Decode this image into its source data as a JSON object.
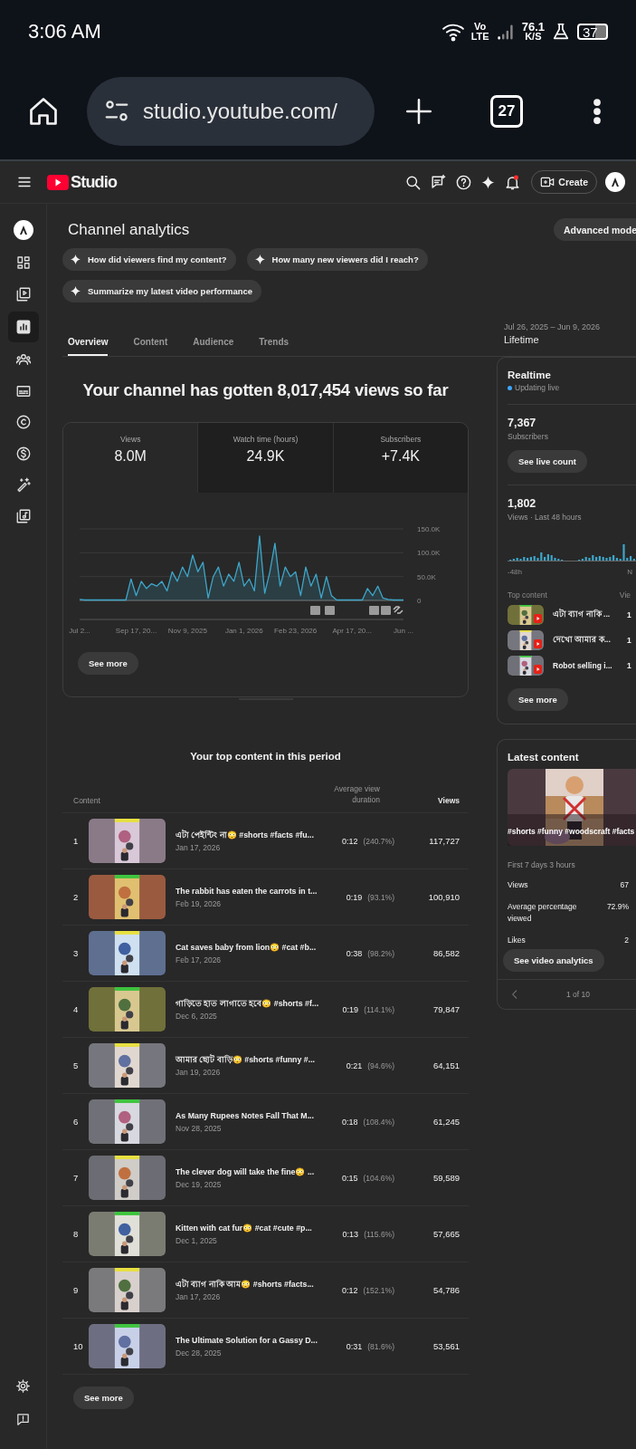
{
  "status_bar": {
    "time": "3:06 AM",
    "network_top": "Vo",
    "network_bottom": "LTE",
    "speed": "76.1",
    "speed_unit": "K/S",
    "battery": "37"
  },
  "browser": {
    "url": "studio.youtube.com/",
    "tab_count": "27"
  },
  "header": {
    "logo_text": "Studio",
    "create_label": "Create"
  },
  "sidebar": {
    "items": [
      {
        "kind": "avatar",
        "selected": false
      },
      {
        "kind": "dashboard",
        "selected": false
      },
      {
        "kind": "content",
        "selected": false
      },
      {
        "kind": "analytics",
        "selected": true
      },
      {
        "kind": "community",
        "selected": false
      },
      {
        "kind": "subtitles",
        "selected": false
      },
      {
        "kind": "copyright",
        "selected": false
      },
      {
        "kind": "earn",
        "selected": false
      },
      {
        "kind": "customization",
        "selected": false
      },
      {
        "kind": "audio",
        "selected": false
      }
    ],
    "bottom_items": [
      {
        "kind": "settings"
      },
      {
        "kind": "feedback"
      }
    ]
  },
  "page": {
    "title": "Channel analytics",
    "advanced_mode": "Advanced mode",
    "suggestions": [
      "How did viewers find my content?",
      "How many new viewers did I reach?",
      "Summarize my latest video performance"
    ],
    "tabs": [
      {
        "label": "Overview",
        "selected": true
      },
      {
        "label": "Content",
        "selected": false
      },
      {
        "label": "Audience",
        "selected": false
      },
      {
        "label": "Trends",
        "selected": false
      }
    ],
    "date_range": "Jul 26, 2025 – Jun 9, 2026",
    "period": "Lifetime"
  },
  "summary": {
    "headline": "Your channel has gotten 8,017,454 views so far",
    "metrics": [
      {
        "label": "Views",
        "value": "8.0M",
        "selected": true
      },
      {
        "label": "Watch time (hours)",
        "value": "24.9K",
        "selected": false
      },
      {
        "label": "Subscribers",
        "value": "+7.4K",
        "selected": false
      }
    ],
    "chart_data": {
      "type": "line",
      "categories": [
        "Jul 2...",
        null,
        null,
        null,
        null,
        null,
        null,
        null,
        null,
        null,
        null,
        "Sep 17, 20...",
        null,
        null,
        null,
        null,
        null,
        null,
        null,
        null,
        null,
        "Nov 9, 2025",
        null,
        null,
        null,
        null,
        null,
        null,
        null,
        null,
        null,
        null,
        "Jan 1, 2026",
        null,
        null,
        null,
        null,
        null,
        null,
        null,
        null,
        null,
        "Feb 23, 2026",
        null,
        null,
        null,
        null,
        null,
        null,
        null,
        null,
        null,
        null,
        "Apr 17, 20...",
        null,
        null,
        null,
        null,
        null,
        null,
        null,
        null,
        null,
        "Jun ..."
      ],
      "series": [
        {
          "color": "#3ea6c9",
          "values": [
            2,
            1,
            1,
            1,
            1,
            1,
            1,
            1,
            1,
            1,
            45,
            10,
            40,
            25,
            35,
            30,
            40,
            20,
            60,
            40,
            70,
            50,
            95,
            60,
            80,
            5,
            50,
            70,
            30,
            55,
            40,
            80,
            30,
            45,
            20,
            135,
            15,
            60,
            120,
            30,
            70,
            50,
            60,
            10,
            70,
            30,
            55,
            5,
            50,
            10,
            1,
            1,
            1,
            1,
            1,
            1,
            25,
            10,
            30,
            5,
            2,
            1,
            1,
            1
          ]
        }
      ],
      "ylim": [
        0,
        150
      ],
      "yticks": [
        {
          "value": 0,
          "label": "0"
        },
        {
          "value": 50,
          "label": "50.0K"
        },
        {
          "value": 100,
          "label": "100.0K"
        },
        {
          "value": 150,
          "label": "150.0K"
        }
      ]
    },
    "see_more": "See more"
  },
  "top_content": {
    "title": "Your top content in this period",
    "columns": [
      "Content",
      "Average view duration",
      "Views"
    ],
    "rows": [
      {
        "rank": "1",
        "title": "এটা পেইন্টিং না😳 #shorts #facts #fu...",
        "date": "Jan 17, 2026",
        "duration": "0:12",
        "percent": "(240.7%)",
        "views": "117,727"
      },
      {
        "rank": "2",
        "title": "The rabbit has eaten the carrots in t...",
        "date": "Feb 19, 2026",
        "duration": "0:19",
        "percent": "(93.1%)",
        "views": "100,910"
      },
      {
        "rank": "3",
        "title": "Cat saves baby from lion😳 #cat #b...",
        "date": "Feb 17, 2026",
        "duration": "0:38",
        "percent": "(98.2%)",
        "views": "86,582"
      },
      {
        "rank": "4",
        "title": "গাড়িতে হাত লাগাতে হবে😳 #shorts #f...",
        "date": "Dec 6, 2025",
        "duration": "0:19",
        "percent": "(114.1%)",
        "views": "79,847"
      },
      {
        "rank": "5",
        "title": "আমার ছোট বাড়ি😳 #shorts #funny #...",
        "date": "Jan 19, 2026",
        "duration": "0:21",
        "percent": "(94.6%)",
        "views": "64,151"
      },
      {
        "rank": "6",
        "title": "As Many Rupees Notes Fall That M...",
        "date": "Nov 28, 2025",
        "duration": "0:18",
        "percent": "(108.4%)",
        "views": "61,245"
      },
      {
        "rank": "7",
        "title": "The clever dog will take the fine😳 ...",
        "date": "Dec 19, 2025",
        "duration": "0:15",
        "percent": "(104.6%)",
        "views": "59,589"
      },
      {
        "rank": "8",
        "title": "Kitten with cat fur😳 #cat #cute #p...",
        "date": "Dec 1, 2025",
        "duration": "0:13",
        "percent": "(115.6%)",
        "views": "57,665"
      },
      {
        "rank": "9",
        "title": "এটা ব্যাগ নাকি আম😳 #shorts #facts...",
        "date": "Jan 17, 2026",
        "duration": "0:12",
        "percent": "(152.1%)",
        "views": "54,786"
      },
      {
        "rank": "10",
        "title": "The Ultimate Solution for a Gassy D...",
        "date": "Dec 28, 2025",
        "duration": "0:31",
        "percent": "(81.6%)",
        "views": "53,561"
      }
    ],
    "see_more": "See more"
  },
  "realtime": {
    "title": "Realtime",
    "status": "Updating live",
    "subscribers": "7,367",
    "subscribers_label": "Subscribers",
    "live_count_button": "See live count",
    "views": "1,802",
    "views_label": "Views · Last 48 hours",
    "axis_start": "-48h",
    "axis_end": "N",
    "top_content_label": "Top content",
    "views_column": "Vie",
    "items": [
      {
        "title": "এটা ব্যাগ নাকি ...",
        "views": "1"
      },
      {
        "title": "দেখো আমার ক...",
        "views": "1"
      },
      {
        "title": "Robot selling i...",
        "views": "1"
      }
    ],
    "see_more": "See more"
  },
  "latest_content": {
    "title": "Latest content",
    "video_title": "#shorts #funny #woodscraft #facts",
    "period": "First 7 days 3 hours",
    "stats": [
      {
        "label": "Views",
        "value": "67"
      },
      {
        "label": "Average percentage viewed",
        "value": "72.9%"
      },
      {
        "label": "Likes",
        "value": "2"
      }
    ],
    "analytics_button": "See video analytics",
    "pager": "1 of 10"
  }
}
